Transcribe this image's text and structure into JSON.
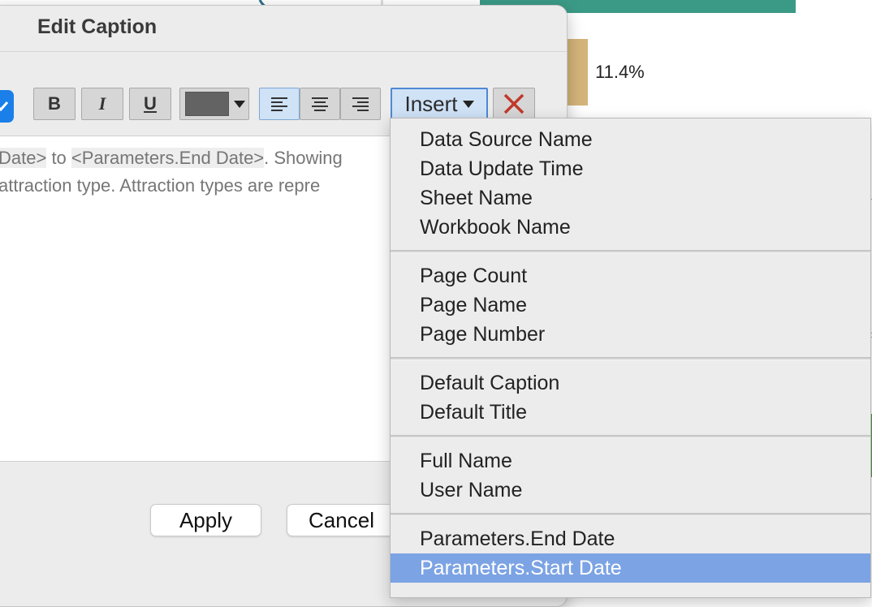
{
  "background": {
    "percent_label": "11.4%",
    "colors": {
      "teal": "#3b9a86",
      "tan": "#d4b47a",
      "green": "#4a9a3a"
    }
  },
  "dialog": {
    "title": "Edit Caption",
    "toolbar": {
      "bold_label": "B",
      "italic_label": "I",
      "underline_label": "U",
      "insert_label": "Insert",
      "font_color": "#636363",
      "icons": [
        "checkbox-icon",
        "align-left-icon",
        "align-center-icon",
        "align-right-icon",
        "chevron-down-icon",
        "clear-icon"
      ]
    },
    "editor": {
      "line1": {
        "tok1": "Date>",
        "t1": " to ",
        "tok2": "<Parameters.End Date>",
        "t2": ". Showing"
      },
      "line2": "attraction type. Attraction types are repre"
    },
    "apply_label": "Apply",
    "cancel_label": "Cancel"
  },
  "insert_menu": {
    "groups": [
      [
        "Data Source Name",
        "Data Update Time",
        "Sheet Name",
        "Workbook Name"
      ],
      [
        "Page Count",
        "Page Name",
        "Page Number"
      ],
      [
        "Default Caption",
        "Default Title"
      ],
      [
        "Full Name",
        "User Name"
      ],
      [
        "Parameters.End Date",
        "Parameters.Start Date"
      ]
    ],
    "highlighted_item": "Parameters.Start Date",
    "highlight_color": "#7ca3e4"
  }
}
